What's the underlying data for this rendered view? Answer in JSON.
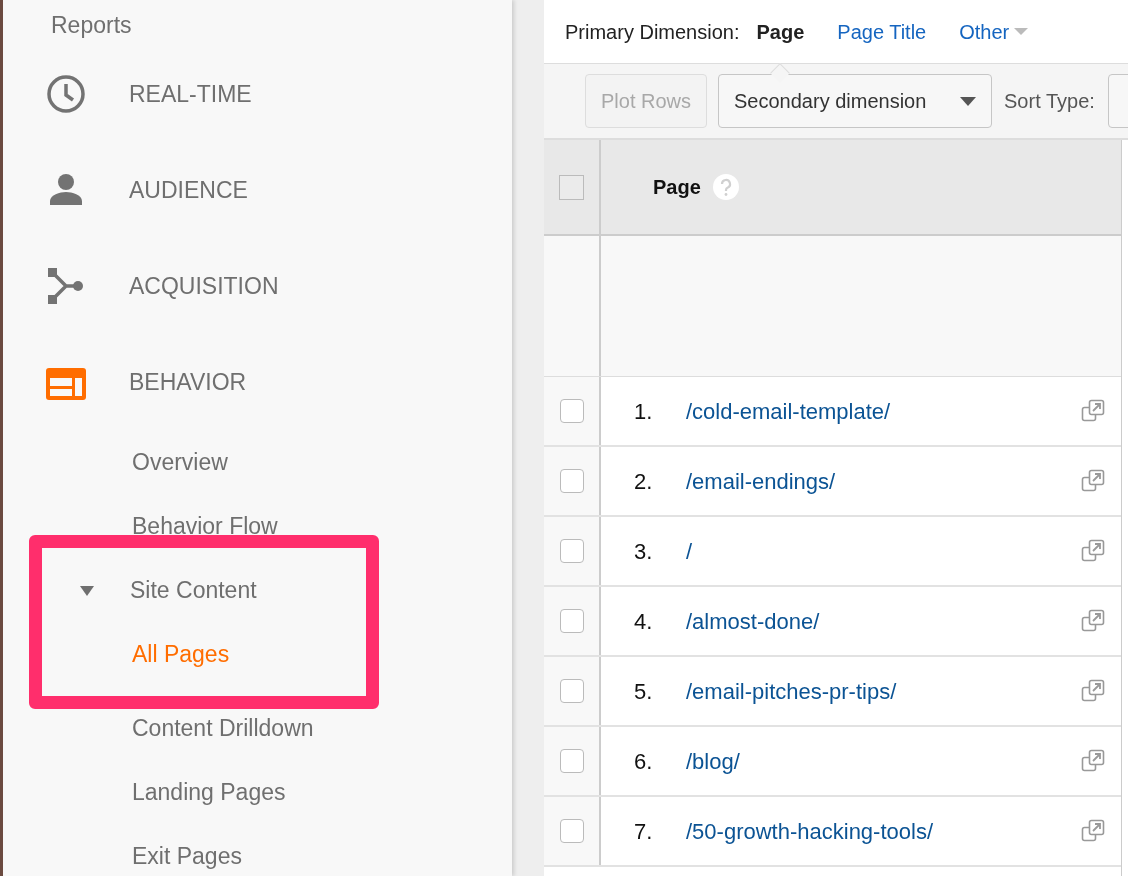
{
  "sidebar": {
    "heading": "Reports",
    "items": [
      {
        "label": "REAL-TIME",
        "selected": false
      },
      {
        "label": "AUDIENCE",
        "selected": false
      },
      {
        "label": "ACQUISITION",
        "selected": false
      },
      {
        "label": "BEHAVIOR",
        "selected": true,
        "children": [
          {
            "label": "Overview",
            "selected": false
          },
          {
            "label": "Behavior Flow",
            "selected": false
          },
          {
            "label": "Site Content",
            "selected": false,
            "expanded": true,
            "children": [
              {
                "label": "All Pages",
                "selected": true
              },
              {
                "label": "Content Drilldown",
                "selected": false
              },
              {
                "label": "Landing Pages",
                "selected": false
              },
              {
                "label": "Exit Pages",
                "selected": false
              }
            ]
          }
        ]
      }
    ]
  },
  "primary_dimension": {
    "label": "Primary Dimension:",
    "options": [
      {
        "label": "Page",
        "selected": true,
        "kind": "link"
      },
      {
        "label": "Page Title",
        "selected": false,
        "kind": "link"
      },
      {
        "label": "Other",
        "selected": false,
        "kind": "dropdown"
      }
    ]
  },
  "toolbar": {
    "plot_rows": {
      "label": "Plot Rows",
      "disabled": true
    },
    "secondary_dimension": "Secondary dimension",
    "sort_type_label": "Sort Type:"
  },
  "table": {
    "header_checked": false,
    "columns": [
      {
        "label": "Page"
      }
    ],
    "rows": [
      {
        "index": "1.",
        "page": "/cold-email-template/",
        "checked": false
      },
      {
        "index": "2.",
        "page": "/email-endings/",
        "checked": false
      },
      {
        "index": "3.",
        "page": "/",
        "checked": false
      },
      {
        "index": "4.",
        "page": "/almost-done/",
        "checked": false
      },
      {
        "index": "5.",
        "page": "/email-pitches-pr-tips/",
        "checked": false
      },
      {
        "index": "6.",
        "page": "/blog/",
        "checked": false
      },
      {
        "index": "7.",
        "page": "/50-growth-hacking-tools/",
        "checked": false
      }
    ]
  }
}
